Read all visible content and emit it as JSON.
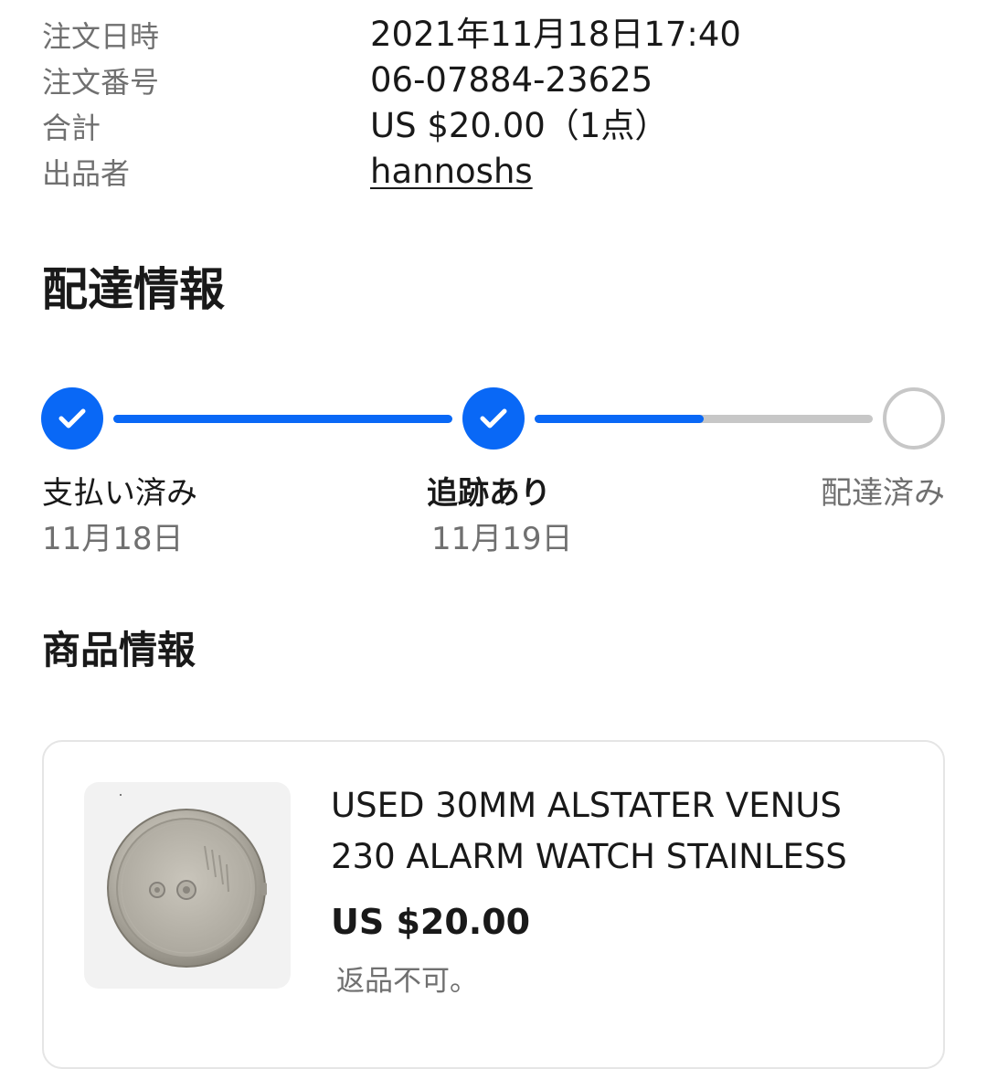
{
  "order_summary": {
    "rows": [
      {
        "label": "注文日時",
        "value": "2021年11月18日17:40"
      },
      {
        "label": "注文番号",
        "value": "06-07884-23625"
      },
      {
        "label": "合計",
        "value": "US $20.00（1点）"
      },
      {
        "label": "出品者",
        "value": "hannoshs"
      }
    ]
  },
  "shipping": {
    "title": "配達情報",
    "steps": [
      {
        "label": "支払い済み",
        "date": "11月18日",
        "status": "done"
      },
      {
        "label": "追跡あり",
        "date": "11月19日",
        "status": "current"
      },
      {
        "label": "配達済み",
        "date": "",
        "status": "pending"
      }
    ],
    "progress_between_step2_and_step3": 0.5,
    "colors": {
      "accent": "#0968f6",
      "inactive": "#c7c7c7"
    }
  },
  "item_section": {
    "title": "商品情報",
    "item": {
      "name": "USED 30MM ALSTATER VENUS 230 ALARM WATCH STAINLESS",
      "price": "US $20.00",
      "return_policy": "返品不可。",
      "image_icon": "watch-case-back-image"
    }
  }
}
